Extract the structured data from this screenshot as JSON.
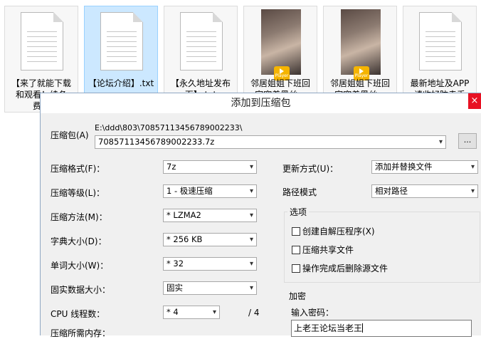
{
  "files": [
    {
      "label": "【来了就能下载和观看！续冬费！",
      "type": "doc",
      "selected": false
    },
    {
      "label": "【论坛介绍】.txt",
      "type": "doc",
      "selected": true
    },
    {
      "label": "【永久地址发布页】.txt",
      "type": "doc",
      "selected": false
    },
    {
      "label": "邻居姐姐下班回家穿着黑丝...",
      "type": "video",
      "badge": "Player",
      "selected": false
    },
    {
      "label": "邻居姐姐下班回家穿着黑丝...",
      "type": "video",
      "badge": "Player",
      "selected": false
    },
    {
      "label": "最新地址及APP请收好防走丢",
      "type": "doc",
      "selected": false
    }
  ],
  "dialog": {
    "title": "添加到压缩包",
    "close": "×",
    "archive_label": "压缩包(A)",
    "archive_path": "E:\\ddd\\803\\70857113456789002233\\",
    "archive_name": "70857113456789002233.7z",
    "browse_label": "...",
    "format_label": "压缩格式(F)：",
    "format_value": "7z",
    "level_label": "压缩等级(L)：",
    "level_value": "1 - 极速压缩",
    "method_label": "压缩方法(M)：",
    "method_value": "* LZMA2",
    "dict_label": "字典大小(D)：",
    "dict_value": "* 256 KB",
    "word_label": "单词大小(W)：",
    "word_value": "* 32",
    "solid_label": "固实数据大小：",
    "solid_value": "固实",
    "threads_label": "CPU 线程数：",
    "threads_value": "* 4",
    "threads_total": "/ 4",
    "memory_label": "压缩所需内存：",
    "update_label": "更新方式(U)：",
    "update_value": "添加并替换文件",
    "path_mode_label": "路径模式",
    "path_mode_value": "相对路径",
    "options_title": "选项",
    "options": [
      "创建自解压程序(X)",
      "压缩共享文件",
      "操作完成后删除源文件"
    ],
    "encryption_title": "加密",
    "password_label": "输入密码：",
    "password_value": "上老王论坛当老王"
  }
}
